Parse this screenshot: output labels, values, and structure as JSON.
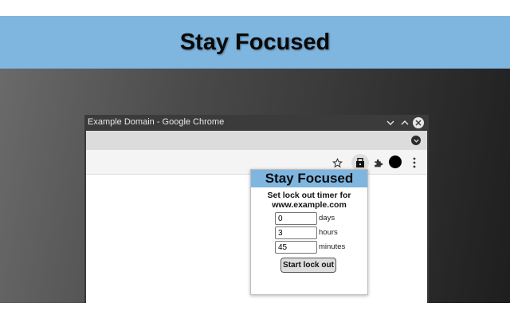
{
  "banner": {
    "title": "Stay Focused"
  },
  "window": {
    "title": "Example Domain - Google Chrome"
  },
  "toolbar": {
    "icons": [
      "star-icon",
      "stay-focused-extension-icon",
      "puzzle-icon",
      "avatar",
      "more-menu-icon"
    ]
  },
  "popup": {
    "title": "Stay Focused",
    "description_line1": "Set lock out timer for",
    "description_line2": "www.example.com",
    "fields": [
      {
        "value": "0",
        "unit": "days"
      },
      {
        "value": "3",
        "unit": "hours"
      },
      {
        "value": "45",
        "unit": "minutes"
      }
    ],
    "start_label": "Start lock out"
  },
  "colors": {
    "banner_bg": "#7fb6e0",
    "window_frame": "#3b3b3b",
    "tabstrip": "#dcdcdc",
    "toolbar": "#f4f4f4"
  }
}
